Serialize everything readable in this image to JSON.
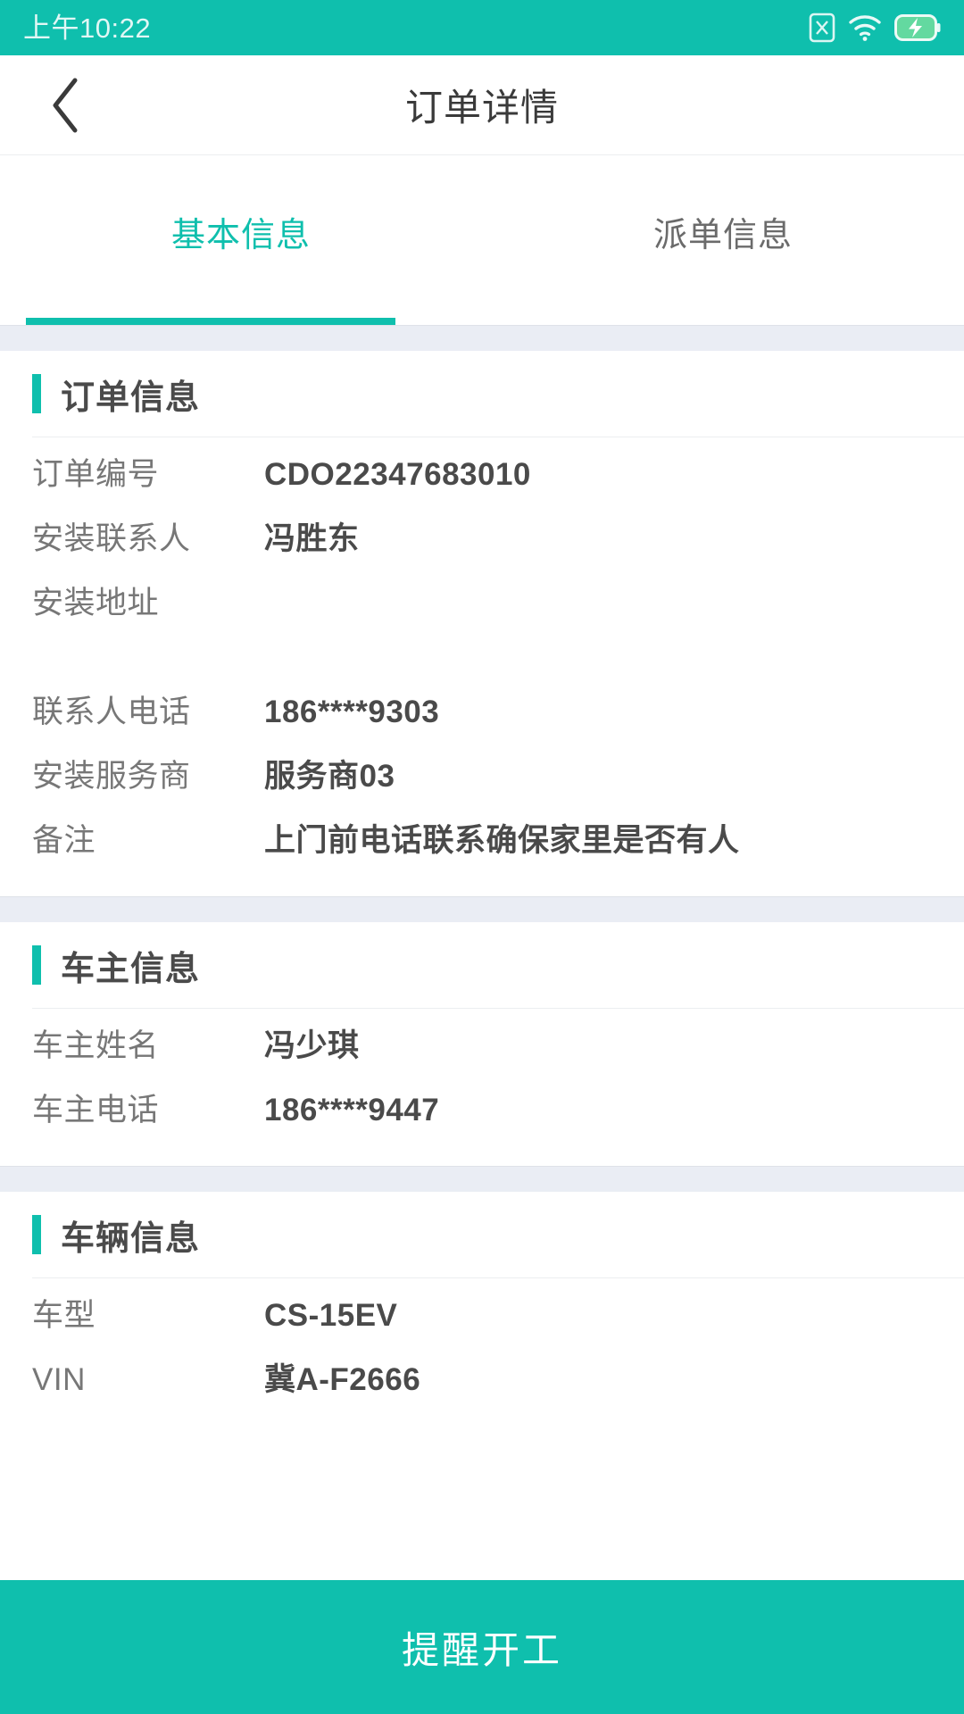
{
  "status_bar": {
    "time": "上午10:22",
    "icons": [
      "sim-off-icon",
      "wifi-icon",
      "battery-charging-icon"
    ]
  },
  "nav": {
    "back_icon": "chevron-left-icon",
    "title": "订单详情"
  },
  "tabs": [
    {
      "label": "基本信息",
      "active": true
    },
    {
      "label": "派单信息",
      "active": false
    }
  ],
  "sections": [
    {
      "title": "订单信息",
      "rows": [
        {
          "label": "订单编号",
          "value": "CDO22347683010"
        },
        {
          "label": "安装联系人",
          "value": "冯胜东"
        },
        {
          "label": "安装地址",
          "value": "",
          "redacted": true
        },
        {
          "label": "联系人电话",
          "value": "186****9303"
        },
        {
          "label": "安装服务商",
          "value": "服务商03"
        },
        {
          "label": "备注",
          "value": "上门前电话联系确保家里是否有人"
        }
      ]
    },
    {
      "title": "车主信息",
      "rows": [
        {
          "label": "车主姓名",
          "value": "冯少琪"
        },
        {
          "label": "车主电话",
          "value": "186****9447"
        }
      ]
    },
    {
      "title": "车辆信息",
      "rows": [
        {
          "label": "车型",
          "value": "CS-15EV"
        },
        {
          "label": "VIN",
          "value": "冀A-F2666"
        }
      ]
    }
  ],
  "bottom_action": {
    "label": "提醒开工"
  },
  "colors": {
    "accent": "#0fbfad",
    "label_text": "#777777",
    "value_text": "#4a4a4a",
    "band": "#eaedf4"
  }
}
